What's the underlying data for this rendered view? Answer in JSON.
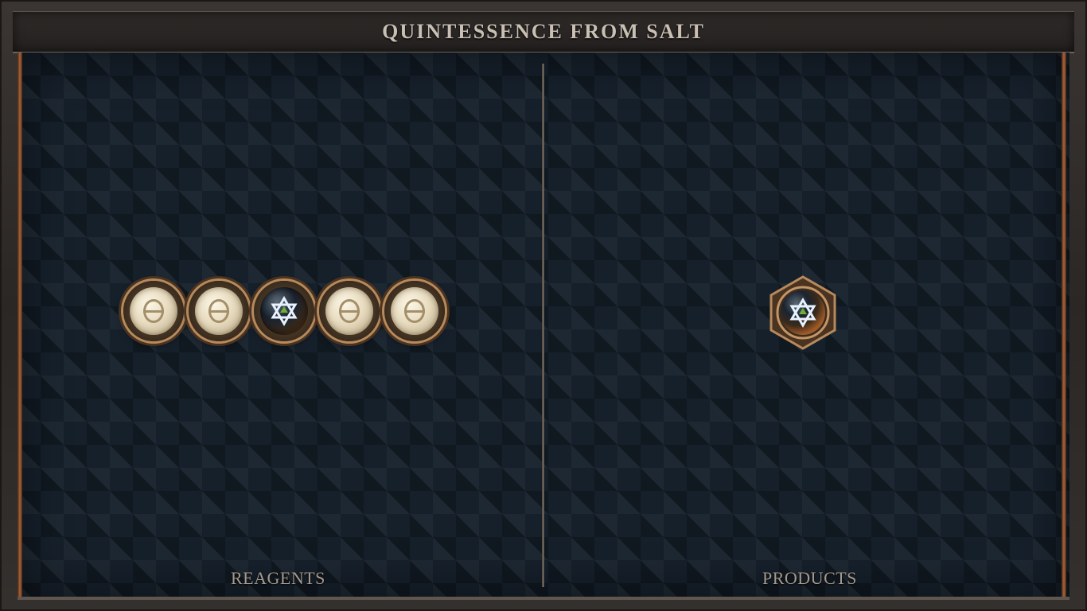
{
  "title": "QUINTESSENCE FROM SALT",
  "labels": {
    "reagents": "REAGENTS",
    "products": "PRODUCTS"
  },
  "reagent_chain": {
    "atoms": [
      "salt",
      "salt",
      "quintessence",
      "salt",
      "salt"
    ]
  },
  "products": {
    "atoms": [
      "quintessence"
    ]
  },
  "colors": {
    "board": "#16202b",
    "frame": "#2b2725",
    "rail": "#a8653a",
    "title_text": "#c9bfb3",
    "label_text": "#a49a8e"
  },
  "icons": {
    "salt": "salt-symbol-icon",
    "quintessence": "star-of-david-icon"
  }
}
